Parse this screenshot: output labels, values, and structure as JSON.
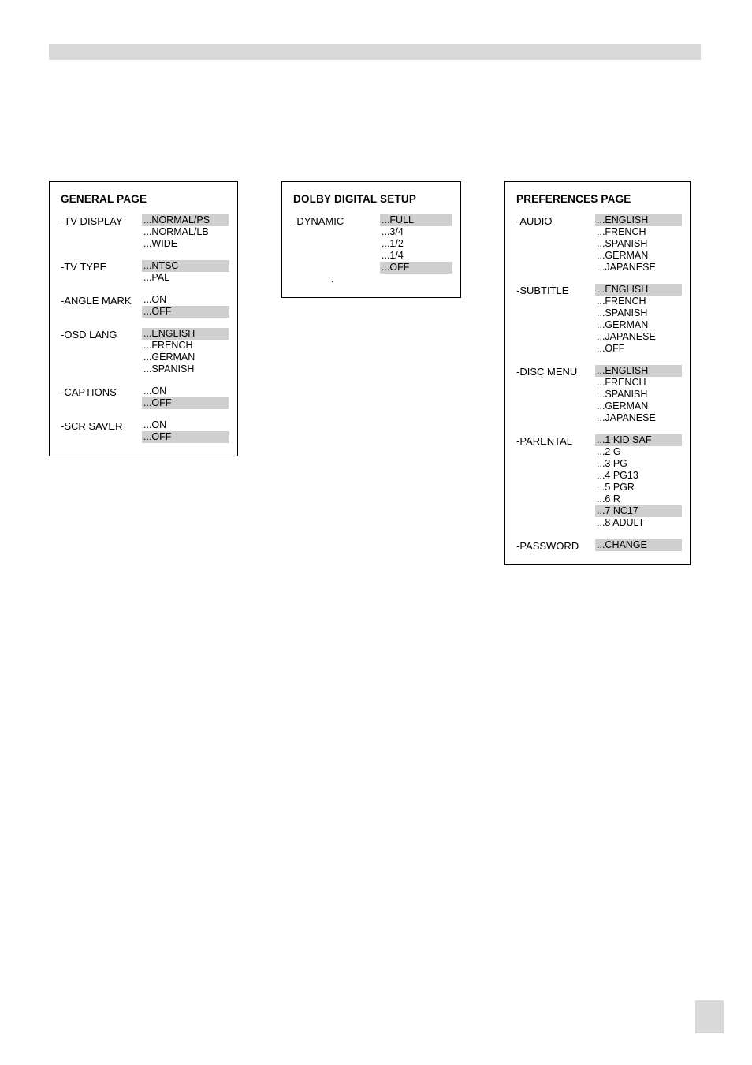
{
  "panel1": {
    "title": "GENERAL PAGE",
    "groups": [
      {
        "label": "-TV DISPLAY",
        "opts": [
          {
            "t": "...NORMAL/PS",
            "hl": true
          },
          {
            "t": "...NORMAL/LB",
            "hl": false
          },
          {
            "t": "...WIDE",
            "hl": false
          }
        ]
      },
      {
        "label": "-TV TYPE",
        "opts": [
          {
            "t": "...NTSC",
            "hl": true
          },
          {
            "t": "...PAL",
            "hl": false
          }
        ]
      },
      {
        "label": "-ANGLE MARK",
        "opts": [
          {
            "t": "...ON",
            "hl": false
          },
          {
            "t": "...OFF",
            "hl": true
          }
        ]
      },
      {
        "label": "-OSD LANG",
        "opts": [
          {
            "t": "...ENGLISH",
            "hl": true
          },
          {
            "t": "...FRENCH",
            "hl": false
          },
          {
            "t": "...GERMAN",
            "hl": false
          },
          {
            "t": "...SPANISH",
            "hl": false
          }
        ]
      },
      {
        "label": "-CAPTIONS",
        "opts": [
          {
            "t": "...ON",
            "hl": false
          },
          {
            "t": "...OFF",
            "hl": true
          }
        ]
      },
      {
        "label": "-SCR SAVER",
        "opts": [
          {
            "t": "...ON",
            "hl": false
          },
          {
            "t": "...OFF",
            "hl": true
          }
        ]
      }
    ]
  },
  "panel2": {
    "title": "DOLBY DIGITAL SETUP",
    "groups": [
      {
        "label": "-DYNAMIC",
        "opts": [
          {
            "t": "...FULL",
            "hl": true
          },
          {
            "t": "...3/4",
            "hl": false
          },
          {
            "t": "...1/2",
            "hl": false
          },
          {
            "t": "...1/4",
            "hl": false
          },
          {
            "t": "...OFF",
            "hl": true
          }
        ]
      }
    ],
    "dot": "."
  },
  "panel3": {
    "title": "PREFERENCES PAGE",
    "groups": [
      {
        "label": "-AUDIO",
        "opts": [
          {
            "t": "...ENGLISH",
            "hl": true
          },
          {
            "t": "...FRENCH",
            "hl": false
          },
          {
            "t": "...SPANISH",
            "hl": false
          },
          {
            "t": "...GERMAN",
            "hl": false
          },
          {
            "t": "...JAPANESE",
            "hl": false
          }
        ]
      },
      {
        "label": "-SUBTITLE",
        "opts": [
          {
            "t": "...ENGLISH",
            "hl": true
          },
          {
            "t": "...FRENCH",
            "hl": false
          },
          {
            "t": "...SPANISH",
            "hl": false
          },
          {
            "t": "...GERMAN",
            "hl": false
          },
          {
            "t": "...JAPANESE",
            "hl": false
          },
          {
            "t": "...OFF",
            "hl": false
          }
        ]
      },
      {
        "label": "-DISC MENU",
        "opts": [
          {
            "t": "...ENGLISH",
            "hl": true
          },
          {
            "t": "...FRENCH",
            "hl": false
          },
          {
            "t": "...SPANISH",
            "hl": false
          },
          {
            "t": "...GERMAN",
            "hl": false
          },
          {
            "t": "...JAPANESE",
            "hl": false
          }
        ]
      },
      {
        "label": "-PARENTAL",
        "opts": [
          {
            "t": "...1 KID SAF",
            "hl": true
          },
          {
            "t": "...2 G",
            "hl": false
          },
          {
            "t": "...3 PG",
            "hl": false
          },
          {
            "t": "...4 PG13",
            "hl": false
          },
          {
            "t": "...5 PGR",
            "hl": false
          },
          {
            "t": "...6 R",
            "hl": false
          },
          {
            "t": "...7 NC17",
            "hl": true
          },
          {
            "t": "...8 ADULT",
            "hl": false
          }
        ]
      },
      {
        "label": "-PASSWORD",
        "opts": [
          {
            "t": "...CHANGE",
            "hl": true
          }
        ]
      }
    ]
  }
}
